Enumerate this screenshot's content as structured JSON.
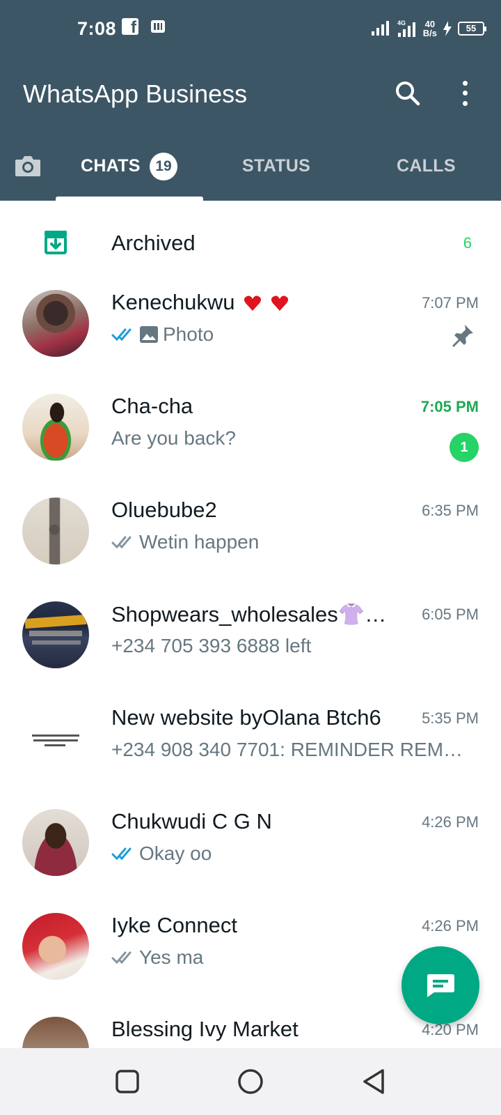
{
  "status_bar": {
    "time": "7:08",
    "network_speed_top": "40",
    "network_speed_unit": "B/s",
    "battery": "55",
    "signal_label": "4G"
  },
  "app": {
    "title": "WhatsApp Business"
  },
  "tabs": [
    {
      "label": "CHATS",
      "badge": "19",
      "active": true
    },
    {
      "label": "STATUS",
      "active": false
    },
    {
      "label": "CALLS",
      "active": false
    }
  ],
  "archived": {
    "label": "Archived",
    "count": "6"
  },
  "chats": [
    {
      "name": "Kenechukwu",
      "time": "7:07 PM",
      "message": "Photo",
      "ticks": "read",
      "pinned": true
    },
    {
      "name": "Cha-cha",
      "time": "7:05 PM",
      "message": "Are you back?",
      "unread": "1"
    },
    {
      "name": "Oluebube2",
      "time": "6:35 PM",
      "message": "Wetin happen",
      "ticks": "delivered"
    },
    {
      "name": "Shopwears_wholesales👚…",
      "time": "6:05 PM",
      "message": "+234 705 393 6888 left"
    },
    {
      "name": "New website byOlana Btch6",
      "time": "5:35 PM",
      "message": "+234 908 340 7701: REMINDER REM…"
    },
    {
      "name": "Chukwudi C G N",
      "time": "4:26 PM",
      "message": "Okay oo",
      "ticks": "read"
    },
    {
      "name": "Iyke Connect",
      "time": "4:26 PM",
      "message": "Yes ma",
      "ticks": "delivered"
    },
    {
      "name": "Blessing Ivy Market",
      "time": "4:20 PM",
      "message": ""
    }
  ],
  "colors": {
    "header": "#3d5665",
    "accent": "#00a884",
    "unread": "#25d366",
    "read_tick": "#1e9ed9",
    "muted": "#667781"
  },
  "icons": [
    "search-icon",
    "more-vert-icon",
    "camera-icon",
    "archive-icon",
    "pin-icon",
    "photo-icon",
    "new-chat-icon"
  ]
}
